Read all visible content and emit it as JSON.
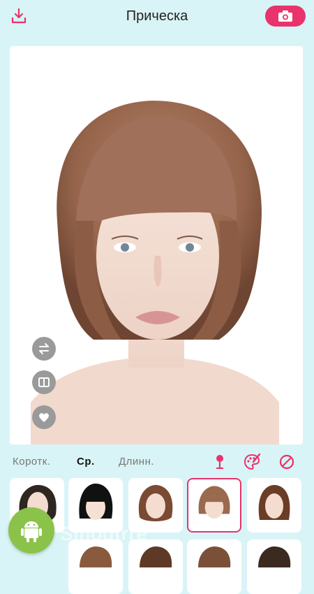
{
  "header": {
    "title": "Прическа"
  },
  "tabs": [
    {
      "label": "Коротк.",
      "active": false
    },
    {
      "label": "Ср.",
      "active": true
    },
    {
      "label": "Длинн.",
      "active": false
    }
  ],
  "tool_icons": [
    "pin-icon",
    "palette-icon",
    "no-style-icon"
  ],
  "side_tools": [
    "swap-icon",
    "compare-icon",
    "heart-icon"
  ],
  "watermark": "Smoutrre",
  "colors": {
    "accent": "#e8336d",
    "background": "#d9f4f6",
    "hair": "#9a6a4f"
  },
  "hairstyles": [
    {
      "id": 1,
      "selected": false
    },
    {
      "id": 2,
      "selected": false
    },
    {
      "id": 3,
      "selected": false
    },
    {
      "id": 4,
      "selected": true
    },
    {
      "id": 5,
      "selected": false
    }
  ]
}
